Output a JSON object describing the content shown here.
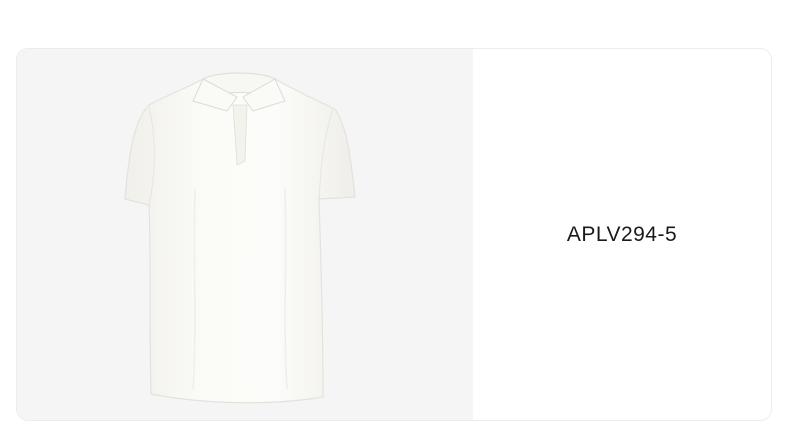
{
  "product": {
    "code": "APLV294-5",
    "image_icon": "polo-shirt-white",
    "image_background": "#f5f5f5",
    "shirt_color": "#fbfbf8"
  }
}
